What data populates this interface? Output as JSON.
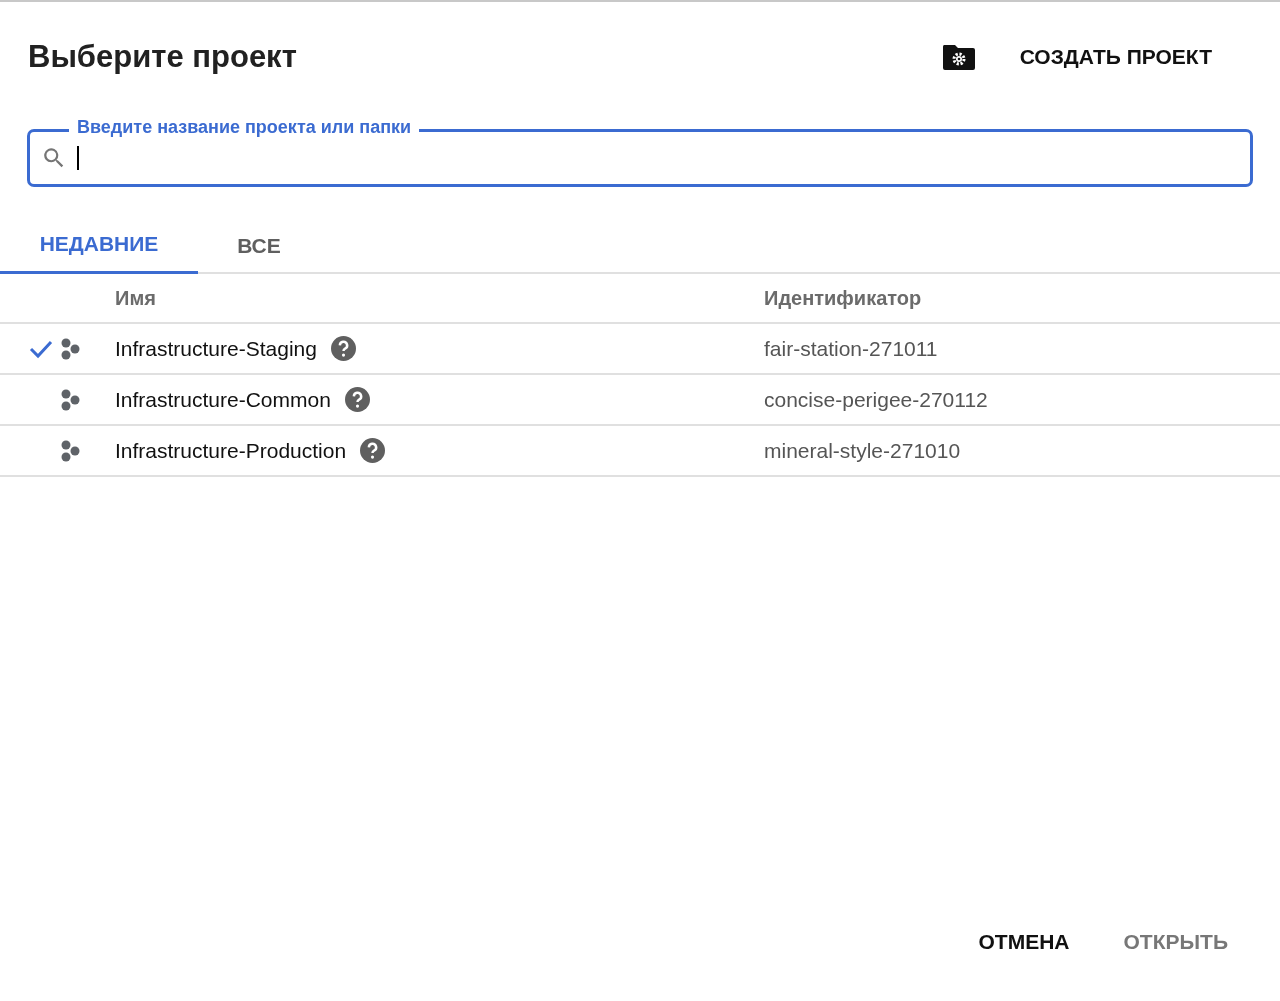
{
  "dialog": {
    "title": "Выберите проект",
    "create_button": "СОЗДАТЬ ПРОЕКТ"
  },
  "search": {
    "label": "Введите название проекта или папки"
  },
  "tabs": [
    {
      "label": "НЕДАВНИЕ",
      "selected": true
    },
    {
      "label": "ВСЕ",
      "selected": false
    }
  ],
  "table": {
    "columns": [
      "Имя",
      "Идентификатор"
    ],
    "rows": [
      {
        "name": "Infrastructure-Staging",
        "id": "fair-station-271011",
        "selected": true
      },
      {
        "name": "Infrastructure-Common",
        "id": "concise-perigee-270112",
        "selected": false
      },
      {
        "name": "Infrastructure-Production",
        "id": "mineral-style-271010",
        "selected": false
      }
    ]
  },
  "buttons": [
    {
      "label": "ОТМЕНА",
      "disabled": false
    },
    {
      "label": "ОТКРЫТЬ",
      "disabled": true
    }
  ]
}
